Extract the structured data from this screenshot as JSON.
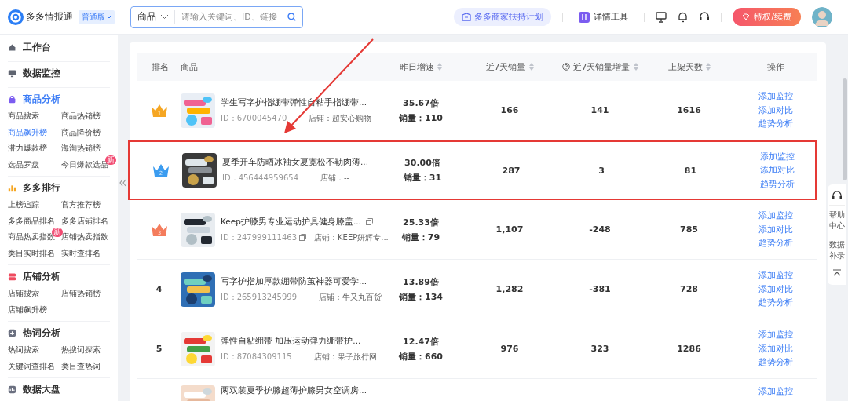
{
  "app": {
    "name": "多多情报通",
    "edition": "普通版"
  },
  "search": {
    "scope": "商品",
    "placeholder": "请输入关键词、ID、链接"
  },
  "topbar": {
    "promo": "多多商家扶持计划",
    "tools": "详情工具",
    "vip": "特权/续费"
  },
  "sidebar": [
    {
      "title": "工作台",
      "selected": false
    },
    {
      "title": "数据监控",
      "selected": false
    },
    {
      "title": "商品分析",
      "selected": true,
      "items": [
        {
          "label": "商品搜索",
          "selected": false
        },
        {
          "label": "商品热销榜",
          "selected": false
        },
        {
          "label": "商品飙升榜",
          "selected": true
        },
        {
          "label": "商品降价榜",
          "selected": false
        },
        {
          "label": "潜力爆款榜",
          "selected": false
        },
        {
          "label": "海淘热销榜",
          "selected": false
        },
        {
          "label": "选品罗盘",
          "selected": false
        },
        {
          "label": "今日爆款选品",
          "selected": false,
          "badge": "新"
        }
      ]
    },
    {
      "title": "多多排行",
      "selected": false,
      "items": [
        {
          "label": "上榜追踪",
          "selected": false
        },
        {
          "label": "官方推荐榜",
          "selected": false
        },
        {
          "label": "多多商品排名",
          "selected": false
        },
        {
          "label": "多多店铺排名",
          "selected": false
        },
        {
          "label": "商品热卖指数",
          "selected": false,
          "badge": "新"
        },
        {
          "label": "店铺热卖指数",
          "selected": false
        },
        {
          "label": "类目实时排名",
          "selected": false
        },
        {
          "label": "实时查排名",
          "selected": false
        }
      ]
    },
    {
      "title": "店铺分析",
      "selected": false,
      "items": [
        {
          "label": "店铺搜索",
          "selected": false
        },
        {
          "label": "店铺热销榜",
          "selected": false
        },
        {
          "label": "店铺飙升榜",
          "selected": false
        }
      ]
    },
    {
      "title": "热词分析",
      "selected": false,
      "items": [
        {
          "label": "热词搜索",
          "selected": false
        },
        {
          "label": "热搜词探索",
          "selected": false
        },
        {
          "label": "关键词查排名",
          "selected": false
        },
        {
          "label": "类目查热词",
          "selected": false
        }
      ]
    },
    {
      "title": "数据大盘",
      "selected": false
    }
  ],
  "table": {
    "columns": [
      {
        "label": "排名",
        "sortable": false,
        "help": false
      },
      {
        "label": "商品",
        "sortable": false,
        "help": false
      },
      {
        "label": "昨日增速",
        "sortable": true,
        "help": false
      },
      {
        "label": "近7天销量",
        "sortable": true,
        "help": false
      },
      {
        "label": "近7天销量增量",
        "sortable": true,
        "help": true
      },
      {
        "label": "上架天数",
        "sortable": true,
        "help": false
      },
      {
        "label": "操作",
        "sortable": false,
        "help": false
      }
    ],
    "rows": [
      {
        "rank": {
          "kind": "crown",
          "number": "1",
          "color": "#f5a623"
        },
        "title": "学生写字护指绷带弹性自粘手指绷带...",
        "id": "ID：6700045470",
        "shop": "店铺：超安心购物",
        "growth": "35.67倍",
        "sales": "销量：110",
        "sales7": "166",
        "increase": "141",
        "days": "1616",
        "actions": [
          "添加监控",
          "添加对比",
          "趋势分析"
        ],
        "highlighted": false,
        "copy_icons": false
      },
      {
        "rank": {
          "kind": "crown",
          "number": "2",
          "color": "#3b9cf0"
        },
        "title": "夏季开车防晒冰袖女夏宽松不勒肉薄...",
        "id": "ID：456444959654",
        "shop": "店铺：--",
        "growth": "30.00倍",
        "sales": "销量：31",
        "sales7": "287",
        "increase": "3",
        "days": "81",
        "actions": [
          "添加监控",
          "添加对比",
          "趋势分析"
        ],
        "highlighted": true,
        "copy_icons": false
      },
      {
        "rank": {
          "kind": "crown",
          "number": "3",
          "color": "#f47c5c"
        },
        "title": "Keep护膝男专业运动护具健身膝盖...",
        "id": "ID：247999111463",
        "shop": "店铺：KEEP妍辉专...",
        "growth": "25.33倍",
        "sales": "销量：79",
        "sales7": "1,107",
        "increase": "-248",
        "days": "785",
        "actions": [
          "添加监控",
          "添加对比",
          "趋势分析"
        ],
        "highlighted": false,
        "copy_icons": true
      },
      {
        "rank": {
          "kind": "number",
          "number": "4"
        },
        "title": "写字护指加厚款绷带防茧神器可爱学...",
        "id": "ID：265913245999",
        "shop": "店铺：牛又丸百货",
        "growth": "13.89倍",
        "sales": "销量：134",
        "sales7": "1,282",
        "increase": "-381",
        "days": "728",
        "actions": [
          "添加监控",
          "添加对比",
          "趋势分析"
        ],
        "highlighted": false,
        "copy_icons": false
      },
      {
        "rank": {
          "kind": "number",
          "number": "5"
        },
        "title": "弹性自粘绷带 加压运动弹力绷带护...",
        "id": "ID：87084309115",
        "shop": "店铺：果子旅行网",
        "growth": "12.47倍",
        "sales": "销量：660",
        "sales7": "976",
        "increase": "323",
        "days": "1286",
        "actions": [
          "添加监控",
          "添加对比",
          "趋势分析"
        ],
        "highlighted": false,
        "copy_icons": false
      },
      {
        "title": "两双装夏季护膝超薄护膝男女空调房...",
        "actions": [
          "添加监控"
        ],
        "highlighted": false,
        "copy_icons": false
      }
    ]
  },
  "float_panel": {
    "items": [
      "帮助中心",
      "数据补录"
    ]
  }
}
